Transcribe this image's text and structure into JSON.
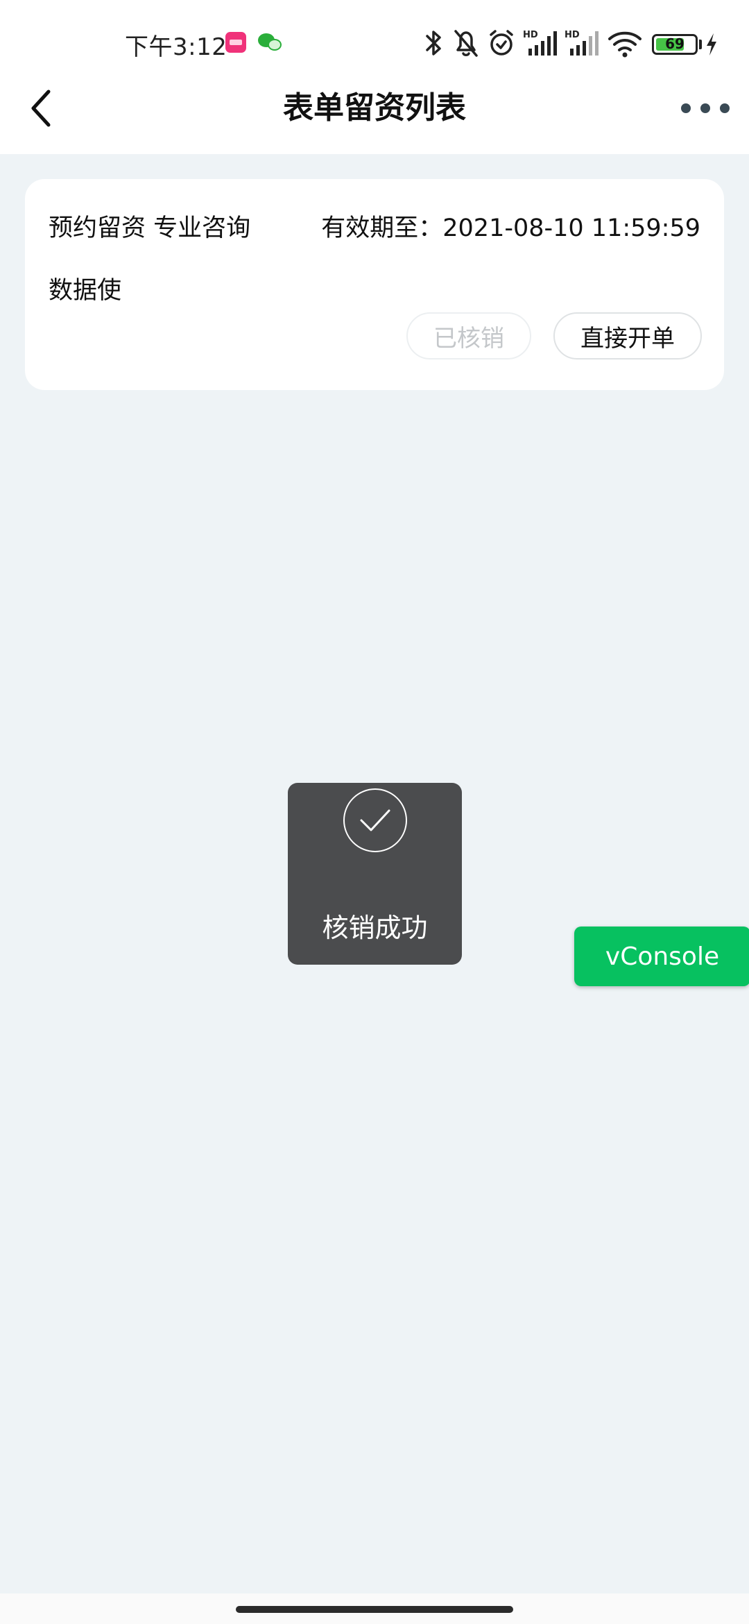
{
  "status_bar": {
    "time": "下午3:12",
    "battery_level": "69",
    "network_labels": [
      "HD",
      "HD"
    ],
    "icons": [
      "lalafy-app-icon",
      "wechat-icon",
      "bluetooth-icon",
      "mute-bell-icon",
      "alarm-icon",
      "signal-icon",
      "signal-icon",
      "wifi-icon",
      "battery-icon",
      "charging-icon"
    ]
  },
  "nav": {
    "title": "表单留资列表",
    "back_icon": "chevron-left-icon",
    "more_icon": "more-dots-icon"
  },
  "list": {
    "items": [
      {
        "type": "预约留资 专业咨询",
        "expiry": "有效期至：2021-08-10 11:59:59",
        "name": "数据使",
        "verified_label": "已核销",
        "open_label": "直接开单"
      }
    ]
  },
  "toast": {
    "message": "核销成功",
    "icon": "check-circle-icon"
  },
  "vconsole": {
    "label": "vConsole"
  },
  "colors": {
    "background": "#eef3f6",
    "toast_bg": "#4b4c4e",
    "vconsole_green": "#07c160",
    "battery_green": "#46c346"
  }
}
